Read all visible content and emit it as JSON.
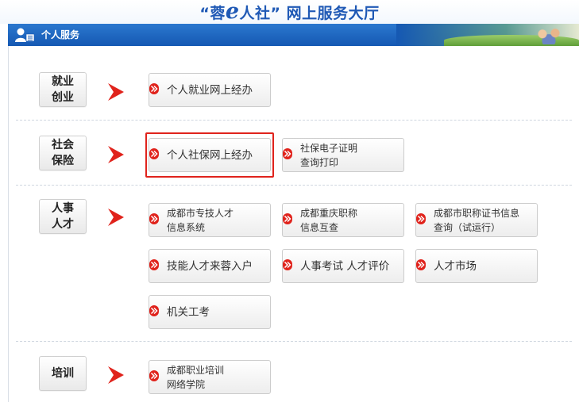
{
  "header": {
    "title_pre": "“蓉",
    "title_e": "e",
    "title_post": "人社” 网上服务大厅"
  },
  "section": {
    "label": "个人服务"
  },
  "categories": [
    {
      "label": "就业\n创业"
    },
    {
      "label": "社会\n保险"
    },
    {
      "label": "人事\n人才"
    },
    {
      "label": "培训"
    }
  ],
  "buttons": {
    "employment_online": "个人就业网上经办",
    "social_insurance_online": "个人社保网上经办",
    "social_cert_query": "社保电子证明\n查询打印",
    "talent_info_system": "成都市专技人才\n信息系统",
    "chongqing_title": "成都重庆职称\n信息互查",
    "title_cert_query": "成都市职称证书信息\n查询（试运行）",
    "skill_talent_hukou": "技能人才来蓉入户",
    "personnel_exam": "人事考试  人才评价",
    "talent_market": "人才市场",
    "civil_exam": "机关工考",
    "vocational_training": "成都职业培训\n网络学院"
  },
  "colors": {
    "title_blue": "#1f59b5",
    "bar_blue": "#1558b3",
    "arrow_red": "#e0231c",
    "highlight_red": "#e0231c"
  }
}
